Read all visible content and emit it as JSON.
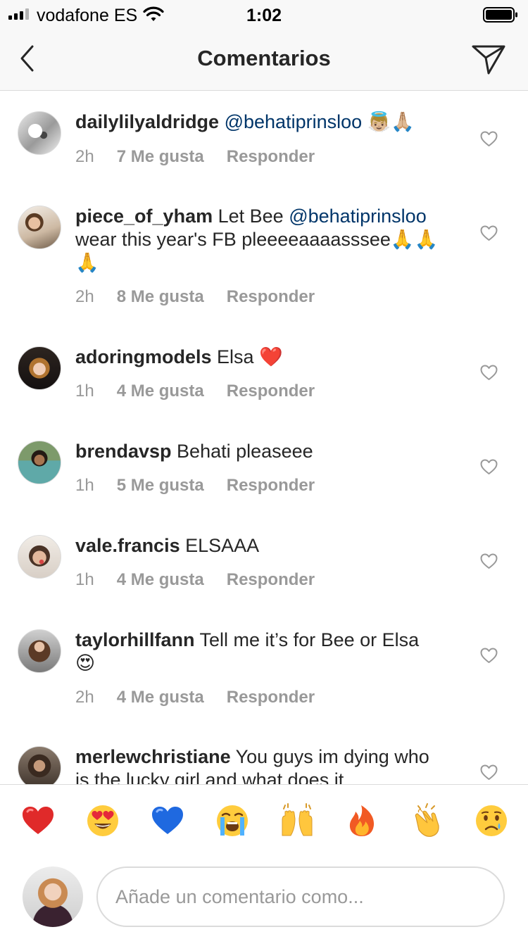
{
  "status_bar": {
    "carrier": "vodafone ES",
    "time": "1:02"
  },
  "header": {
    "title": "Comentarios"
  },
  "comments": [
    {
      "username": "dailylilyaldridge",
      "mention": "@behatiprinsloo",
      "text": " 👼🏼🙏🏼",
      "time": "2h",
      "likes": "7 Me gusta",
      "reply": "Responder"
    },
    {
      "username": "piece_of_yham",
      "text_before": " Let Bee ",
      "mention": "@behatiprinsloo",
      "text": " wear this year's FB pleeeeaaaasssee🙏🙏🙏",
      "time": "2h",
      "likes": "8 Me gusta",
      "reply": "Responder"
    },
    {
      "username": "adoringmodels",
      "text": " Elsa ❤️",
      "time": "1h",
      "likes": "4 Me gusta",
      "reply": "Responder"
    },
    {
      "username": "brendavsp",
      "text": " Behati pleaseee",
      "time": "1h",
      "likes": "5 Me gusta",
      "reply": "Responder"
    },
    {
      "username": "vale.francis",
      "text": " ELSAAA",
      "time": "1h",
      "likes": "4 Me gusta",
      "reply": "Responder"
    },
    {
      "username": "taylorhillfann",
      "text": " Tell me it’s for Bee or Elsa 😍",
      "time": "2h",
      "likes": "4 Me gusta",
      "reply": "Responder"
    },
    {
      "username": "merlewchristiane",
      "text": " You guys im dying who is the lucky girl and what does it"
    }
  ],
  "emoji_bar": [
    {
      "name": "red-heart",
      "char": "❤️"
    },
    {
      "name": "heart-eyes",
      "char": "😍"
    },
    {
      "name": "blue-heart",
      "char": "💙"
    },
    {
      "name": "loudly-crying",
      "char": "😭"
    },
    {
      "name": "raising-hands",
      "char": "🙌"
    },
    {
      "name": "fire",
      "char": "🔥"
    },
    {
      "name": "clapping-hands",
      "char": "👏"
    },
    {
      "name": "crying-face",
      "char": "😢"
    }
  ],
  "comment_input": {
    "placeholder": "Añade un comentario como..."
  },
  "colors": {
    "mention": "#003569",
    "meta": "#999999",
    "border": "#dbdbdb",
    "bar_background": "#f8f8f8"
  }
}
